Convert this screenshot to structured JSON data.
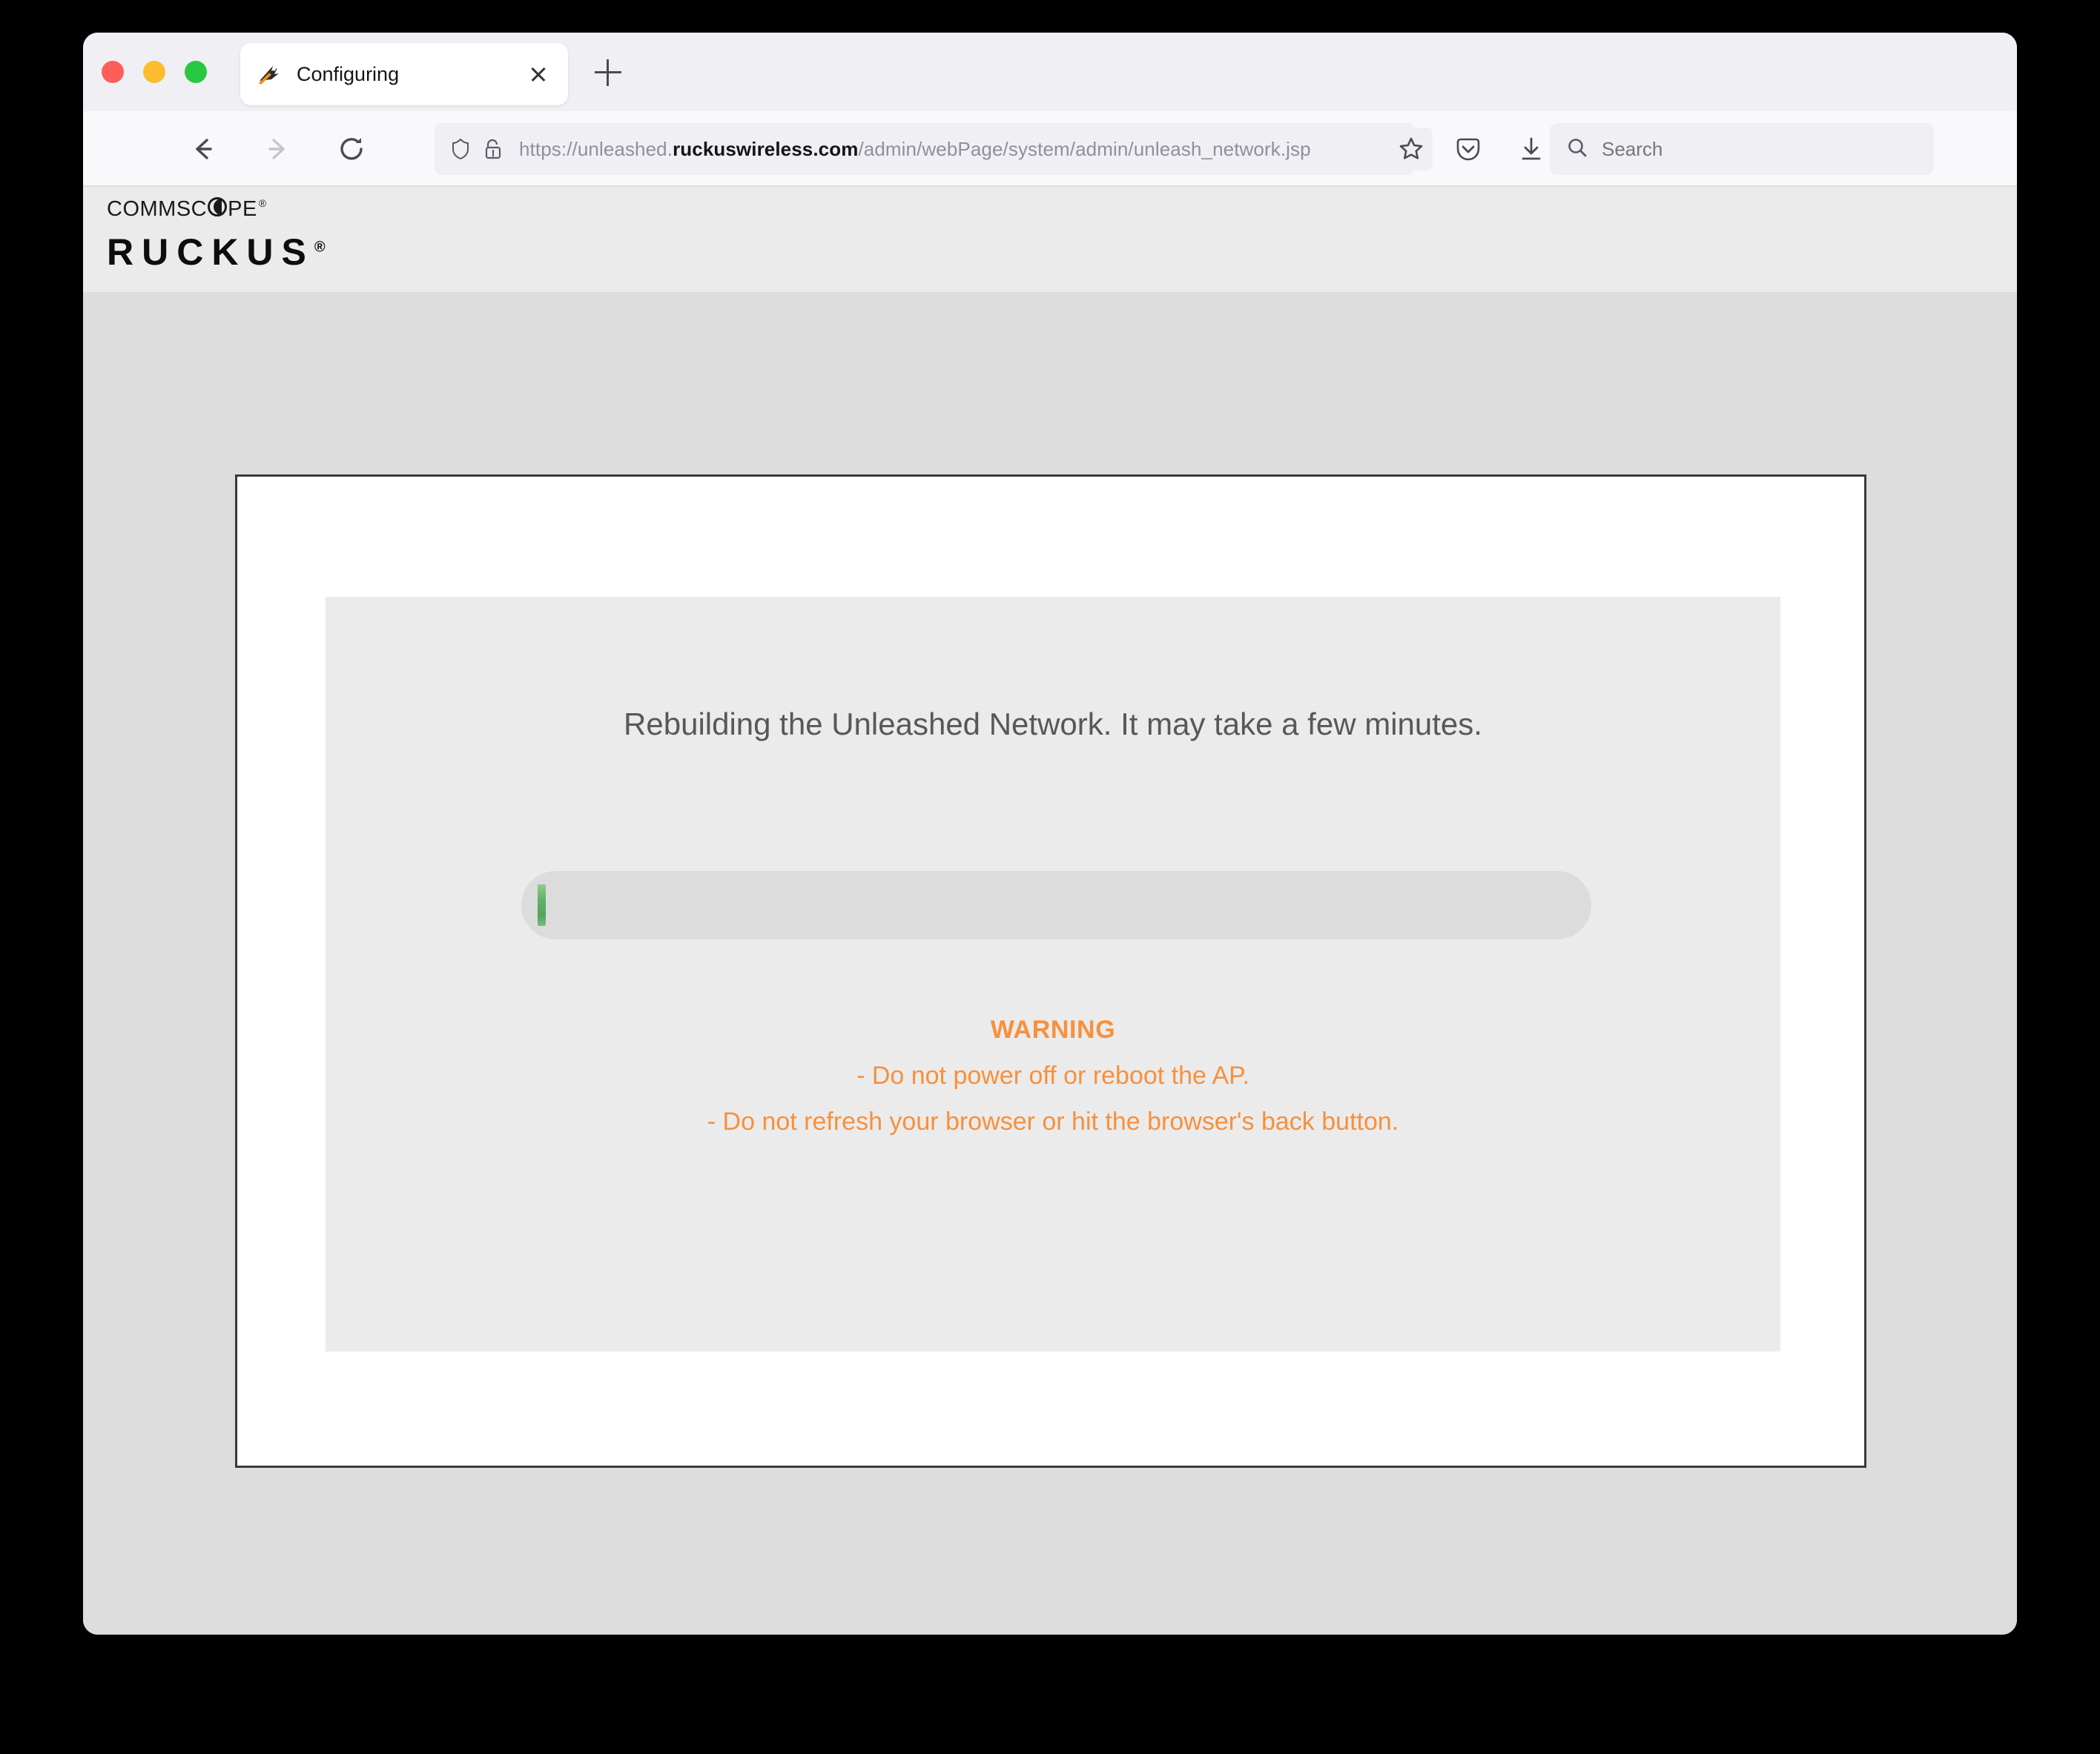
{
  "browser": {
    "tab": {
      "title": "Configuring",
      "favicon": "ruckus-favicon-icon",
      "close_label": "close-tab"
    },
    "new_tab_label": "+",
    "nav": {
      "back": "back-arrow-icon",
      "forward": "forward-arrow-icon",
      "reload": "reload-icon"
    },
    "url": {
      "protocol": "https://unleashed.",
      "domain": "ruckuswireless.com",
      "path": "/admin/webPage/system/admin/unleash_network.jsp",
      "full": "https://unleashed.ruckuswireless.com/admin/webPage/system/admin/unleash_network.jsp",
      "shield_icon": "shield-icon",
      "lock_icon": "lock-warning-icon",
      "bookmark_icon": "bookmark-star-icon"
    },
    "toolbar": {
      "pocket_icon": "pocket-icon",
      "download_icon": "download-icon",
      "menu_icon": "hamburger-menu-icon"
    },
    "search": {
      "placeholder": "Search",
      "icon": "search-icon"
    },
    "window_controls": {
      "close": "#fc5f57",
      "minimize": "#fdbc2e",
      "maximize": "#28c840"
    }
  },
  "brand": {
    "commscope_pre": "COMMSC",
    "commscope_post": "PE",
    "commscope_reg": "®",
    "ruckus": "RUCKUS",
    "ruckus_reg": "®"
  },
  "page": {
    "status_message": "Rebuilding the Unleashed Network. It may take a few minutes.",
    "progress": {
      "percent": 1,
      "fill_color": "#62b369",
      "track_color": "#dcdcdc"
    },
    "warning": {
      "title": "WARNING",
      "color": "#f7903d",
      "lines": [
        "- Do not power off or reboot the AP.",
        "- Do not refresh your browser or hit the browser's back button."
      ]
    }
  },
  "colors": {
    "page_background": "#dddddd",
    "card_background": "#ffffff",
    "card_border": "#3a3a3a",
    "panel_background": "#ebebeb",
    "accent_orange": "#f7903d",
    "text_gray": "#58585a"
  }
}
